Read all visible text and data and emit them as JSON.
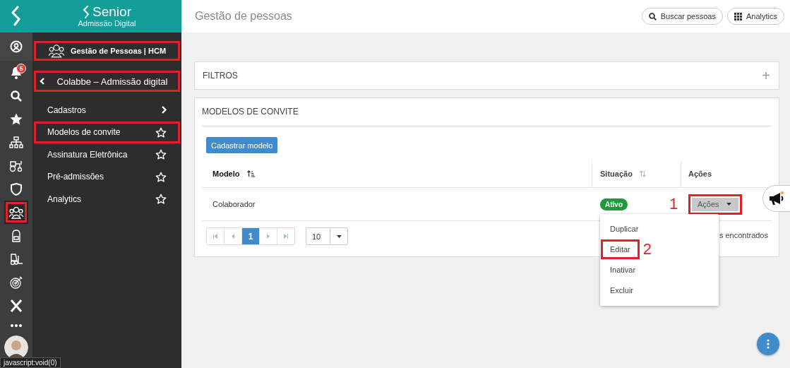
{
  "brand": {
    "name": "Senior",
    "subtitle": "Admissão Digital"
  },
  "rail": {
    "items": [
      {
        "highlighted": false
      },
      {
        "highlighted": false,
        "badge": "5"
      },
      {
        "highlighted": false
      },
      {
        "highlighted": false
      },
      {
        "highlighted": false
      },
      {
        "highlighted": false
      },
      {
        "highlighted": false
      },
      {
        "highlighted": true
      },
      {
        "highlighted": false
      },
      {
        "highlighted": false
      },
      {
        "highlighted": false
      },
      {
        "highlighted": false
      },
      {
        "highlighted": false
      }
    ],
    "status_tooltip": "javascript:void(0)"
  },
  "menu": {
    "module": {
      "label": "Gestão de Pessoas | HCM",
      "highlighted": true
    },
    "back": {
      "label": "Colabbe – Admissão digital",
      "highlighted": true
    },
    "items": [
      {
        "label": "Cadastros",
        "kind": "submenu",
        "highlighted": false
      },
      {
        "label": "Modelos de convite",
        "kind": "favorite",
        "highlighted": true
      },
      {
        "label": "Assinatura Eletrônica",
        "kind": "favorite",
        "highlighted": false
      },
      {
        "label": "Pré-admissões",
        "kind": "favorite",
        "highlighted": false
      },
      {
        "label": "Analytics",
        "kind": "favorite",
        "highlighted": false
      }
    ]
  },
  "header": {
    "title": "Gestão de pessoas",
    "buttons": [
      {
        "label": "Buscar pessoas",
        "kind": "search"
      },
      {
        "label": "Analytics",
        "kind": "apps"
      }
    ]
  },
  "filters": {
    "title": "FILTROS",
    "expand": "+"
  },
  "models": {
    "title": "MODELOS DE CONVITE",
    "create_button": "Cadastrar modelo",
    "table": {
      "columns": [
        {
          "label": "Modelo",
          "sorted": true
        },
        {
          "label": "Situação",
          "sorted": false
        },
        {
          "label": "Ações"
        }
      ],
      "rows": [
        {
          "modelo": "Colaborador",
          "situacao": "Ativo",
          "actions": {
            "label": "Ações",
            "highlighted": true,
            "annotation": "1",
            "expanded": true
          }
        }
      ]
    },
    "pagination": {
      "pages": [
        {
          "label": "1",
          "selected": true
        }
      ],
      "page_size": "10",
      "result_text": "s encontrados"
    }
  },
  "dropdown": {
    "items": [
      {
        "label": "Duplicar",
        "highlighted": false
      },
      {
        "label": "Editar",
        "highlighted": true,
        "annotation": "2"
      },
      {
        "label": "Inativar",
        "highlighted": false
      },
      {
        "label": "Excluir",
        "highlighted": false
      }
    ]
  }
}
